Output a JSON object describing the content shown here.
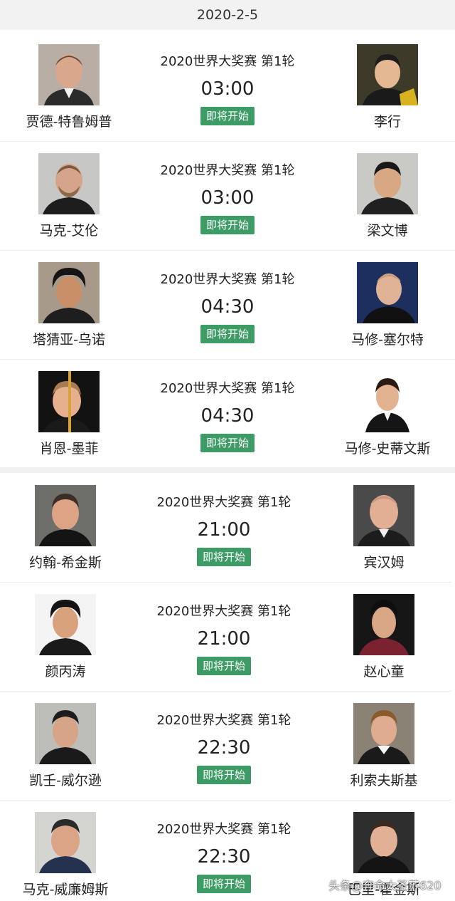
{
  "date": "2020-2-5",
  "status_color": "#3d9b66",
  "matches": [
    {
      "tournament": "2020世界大奖赛 第1轮",
      "time": "03:00",
      "status": "即将开始",
      "left_player": "贾德-特鲁姆普",
      "right_player": "李行"
    },
    {
      "tournament": "2020世界大奖赛 第1轮",
      "time": "03:00",
      "status": "即将开始",
      "left_player": "马克-艾伦",
      "right_player": "梁文博"
    },
    {
      "tournament": "2020世界大奖赛 第1轮",
      "time": "04:30",
      "status": "即将开始",
      "left_player": "塔猜亚-乌诺",
      "right_player": "马修-塞尔特"
    },
    {
      "tournament": "2020世界大奖赛 第1轮",
      "time": "04:30",
      "status": "即将开始",
      "left_player": "肖恩-墨菲",
      "right_player": "马修-史蒂文斯"
    },
    {
      "tournament": "2020世界大奖赛 第1轮",
      "time": "21:00",
      "status": "即将开始",
      "left_player": "约翰-希金斯",
      "right_player": "宾汉姆"
    },
    {
      "tournament": "2020世界大奖赛 第1轮",
      "time": "21:00",
      "status": "即将开始",
      "left_player": "颜丙涛",
      "right_player": "赵心童"
    },
    {
      "tournament": "2020世界大奖赛 第1轮",
      "time": "22:30",
      "status": "即将开始",
      "left_player": "凯壬-威尔逊",
      "right_player": "利索夫斯基"
    },
    {
      "tournament": "2020世界大奖赛 第1轮",
      "time": "22:30",
      "status": "即将开始",
      "left_player": "马克-威廉姆斯",
      "right_player": "巴里-霍金斯"
    }
  ],
  "watermark": "头条@奔命大圣苏620"
}
